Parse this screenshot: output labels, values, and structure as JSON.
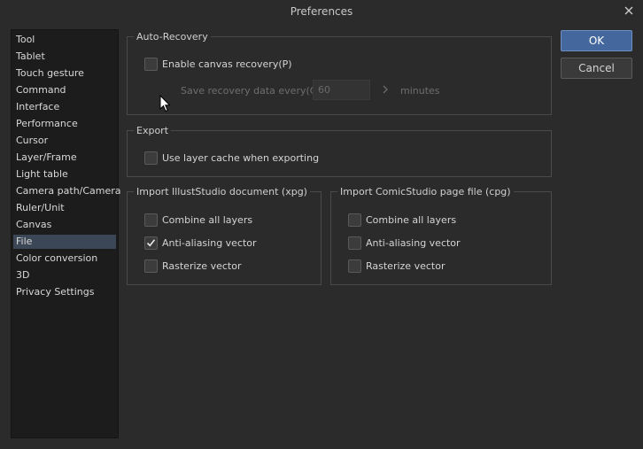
{
  "window": {
    "title": "Preferences"
  },
  "sidebar": {
    "selected_index": 12,
    "items": [
      {
        "label": "Tool"
      },
      {
        "label": "Tablet"
      },
      {
        "label": "Touch gesture"
      },
      {
        "label": "Command"
      },
      {
        "label": "Interface"
      },
      {
        "label": "Performance"
      },
      {
        "label": "Cursor"
      },
      {
        "label": "Layer/Frame"
      },
      {
        "label": "Light table"
      },
      {
        "label": "Camera path/Camera"
      },
      {
        "label": "Ruler/Unit"
      },
      {
        "label": "Canvas"
      },
      {
        "label": "File"
      },
      {
        "label": "Color conversion"
      },
      {
        "label": "3D"
      },
      {
        "label": "Privacy Settings"
      }
    ]
  },
  "auto_recovery": {
    "title": "Auto-Recovery",
    "enable_label": "Enable canvas recovery(P)",
    "enable_checked": false,
    "save_label": "Save recovery data every(Q):",
    "interval_value": "60",
    "unit": "minutes"
  },
  "export": {
    "title": "Export",
    "layer_cache_label": "Use layer cache when exporting",
    "layer_cache_checked": false
  },
  "import_illust": {
    "title": "Import IllustStudio document (xpg)",
    "combine_label": "Combine all layers",
    "combine_checked": false,
    "antialias_label": "Anti-aliasing vector",
    "antialias_checked": true,
    "rasterize_label": "Rasterize vector",
    "rasterize_checked": false
  },
  "import_comic": {
    "title": "Import ComicStudio page file (cpg)",
    "combine_label": "Combine all layers",
    "combine_checked": false,
    "antialias_label": "Anti-aliasing vector",
    "antialias_checked": false,
    "rasterize_label": "Rasterize vector",
    "rasterize_checked": false
  },
  "buttons": {
    "ok": "OK",
    "cancel": "Cancel"
  },
  "colors": {
    "background": "#2b2b2b",
    "sidebar": "#1c1c1c",
    "selection": "#3b4656",
    "accent": "#44679e"
  }
}
